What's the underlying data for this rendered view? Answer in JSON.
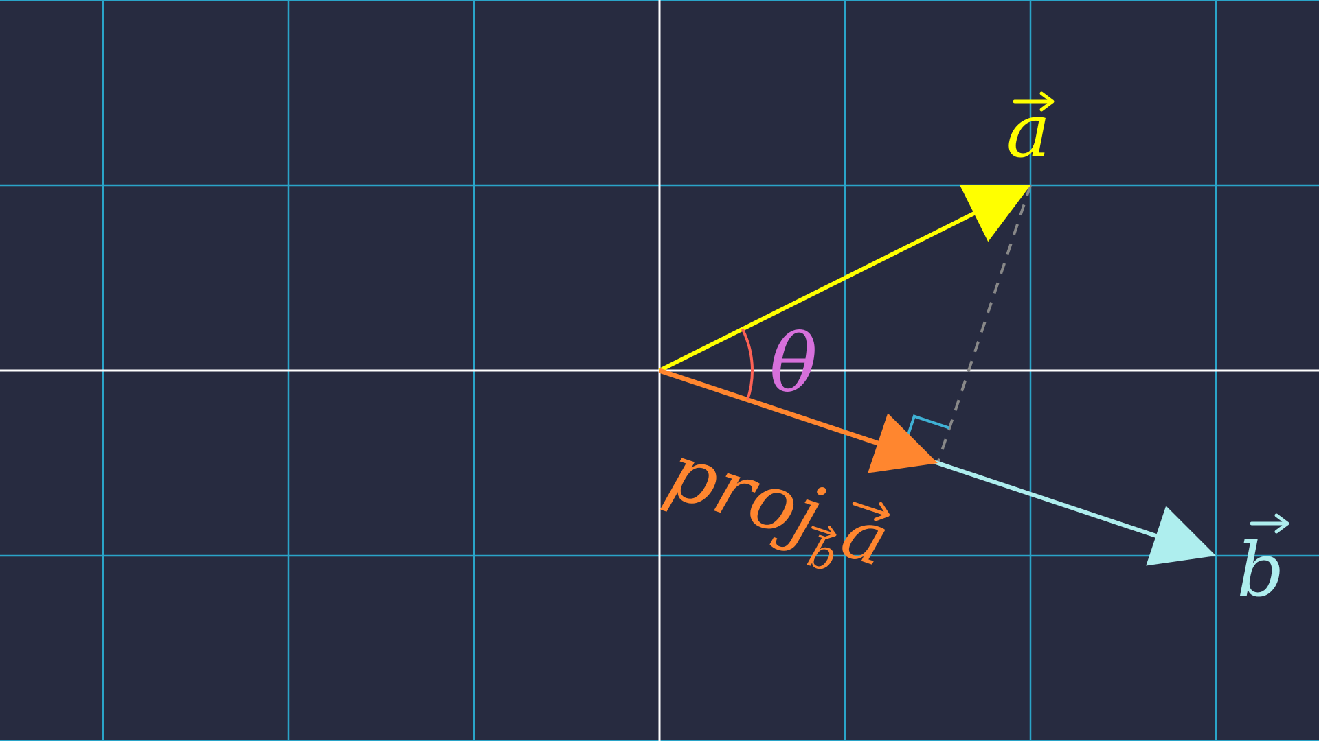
{
  "canvas": {
    "background_color": "#272b40",
    "grid_color": "#2aa4c8",
    "axis_color": "#ffffff"
  },
  "plane": {
    "x_range": [
      -3.5,
      3.5
    ],
    "y_range": [
      -2,
      2
    ],
    "grid_step": 1,
    "grid": true
  },
  "vectors": {
    "a": {
      "label": "a",
      "end": [
        2,
        1
      ],
      "color": "#ffff00"
    },
    "b": {
      "label": "b",
      "end": [
        3,
        -1
      ],
      "color": "#aeeeee"
    },
    "projection": {
      "label_main": "proj",
      "label_sub": "b",
      "label_vec": "a",
      "end": [
        1.5,
        -0.5
      ],
      "color": "#ff862f"
    }
  },
  "angle": {
    "label": "θ",
    "arc_color": "#fc6255",
    "label_color": "#d670db"
  },
  "perpendicular": {
    "dash_color": "#888888",
    "right_angle_color": "#3fb1d4"
  }
}
